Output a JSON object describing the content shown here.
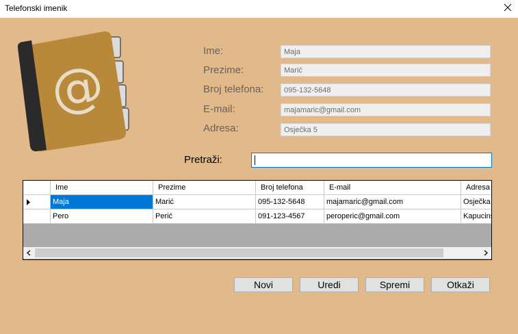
{
  "window": {
    "title": "Telefonski imenik"
  },
  "icons": {
    "close": "close-icon",
    "book": "address-book-icon"
  },
  "form": {
    "ime_label": "Ime:",
    "ime_value": "Maja",
    "prezime_label": "Prezime:",
    "prezime_value": "Marić",
    "broj_label": "Broj telefona:",
    "broj_value": "095-132-5648",
    "email_label": "E-mail:",
    "email_value": "majamaric@gmail.com",
    "adresa_label": "Adresa:",
    "adresa_value": "Osječka 5"
  },
  "search": {
    "label": "Pretraži:",
    "value": ""
  },
  "grid": {
    "columns": [
      "Ime",
      "Prezime",
      "Broj telefona",
      "E-mail",
      "Adresa"
    ],
    "rows": [
      [
        "Maja",
        "Marić",
        "095-132-5648",
        "majamaric@gmail.com",
        "Osječka"
      ],
      [
        "Pero",
        "Perić",
        "091-123-4567",
        "peroperic@gmail.com",
        "Kapucins"
      ]
    ],
    "selected_row": 0
  },
  "buttons": {
    "novi": "Novi",
    "uredi": "Uredi",
    "spremi": "Spremi",
    "otkazi": "Otkaži"
  },
  "colors": {
    "background": "#e1b98a",
    "selection": "#0078d7",
    "book_cover": "#b8893a"
  }
}
